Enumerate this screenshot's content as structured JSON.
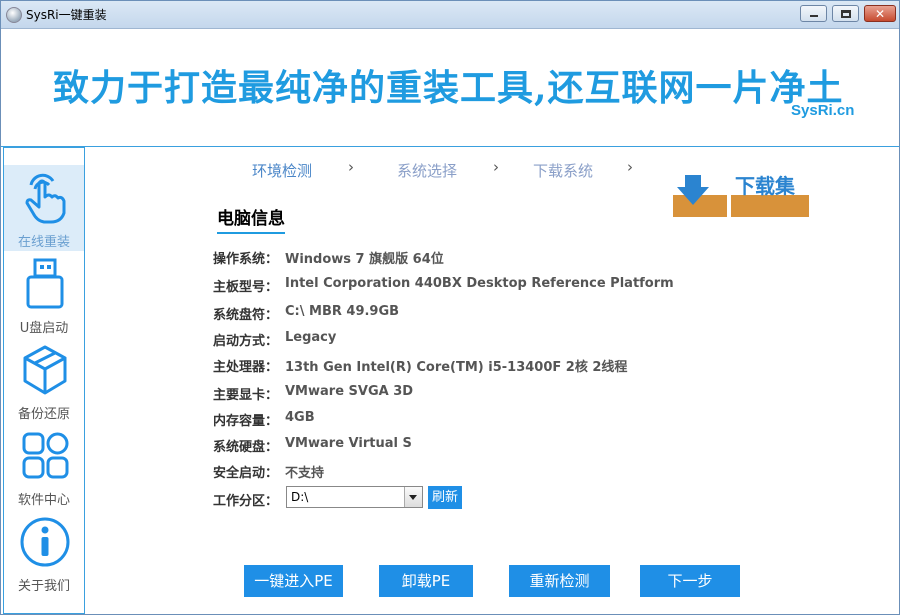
{
  "window": {
    "title": "SysRi一键重装"
  },
  "banner": {
    "slogan": "致力于打造最纯净的重装工具,还互联网一片净土",
    "site": "SysRi.cn"
  },
  "sidebar": {
    "items": [
      {
        "label": "在线重装",
        "icon": "hand-tap-icon",
        "active": true
      },
      {
        "label": "U盘启动",
        "icon": "usb-drive-icon",
        "active": false
      },
      {
        "label": "备份还原",
        "icon": "box-icon",
        "active": false
      },
      {
        "label": "软件中心",
        "icon": "grid-apps-icon",
        "active": false
      },
      {
        "label": "关于我们",
        "icon": "info-icon",
        "active": false
      }
    ]
  },
  "steps": [
    {
      "label": "环境检测",
      "state": "current"
    },
    {
      "label": "系统选择",
      "state": "pending"
    },
    {
      "label": "下载系统",
      "state": "pending"
    }
  ],
  "watermark": {
    "text": "下载集"
  },
  "info": {
    "title": "电脑信息",
    "rows": [
      {
        "label": "操作系统：",
        "value": "Windows 7 旗舰版   64位"
      },
      {
        "label": "主板型号：",
        "value": "Intel Corporation 440BX Desktop Reference Platform"
      },
      {
        "label": "系统盘符：",
        "value": "C:\\ MBR 49.9GB"
      },
      {
        "label": "启动方式：",
        "value": "Legacy"
      },
      {
        "label": "主处理器：",
        "value": "13th Gen Intel(R) Core(TM) i5-13400F 2核 2线程"
      },
      {
        "label": "主要显卡：",
        "value": "VMware SVGA 3D"
      },
      {
        "label": "内存容量：",
        "value": "4GB"
      },
      {
        "label": "系统硬盘：",
        "value": "VMware Virtual S"
      },
      {
        "label": "安全启动：",
        "value": "不支持"
      }
    ],
    "partition_label": "工作分区：",
    "partition_value": "D:\\",
    "refresh_label": "刷新"
  },
  "actions": {
    "enter_pe": "一键进入PE",
    "uninstall_pe": "卸载PE",
    "recheck": "重新检测",
    "next": "下一步"
  },
  "colors": {
    "accent": "#1f8fe6",
    "slogan": "#1f9be0",
    "step_current": "#4a86c8",
    "step_pending": "#8a9fc8"
  }
}
